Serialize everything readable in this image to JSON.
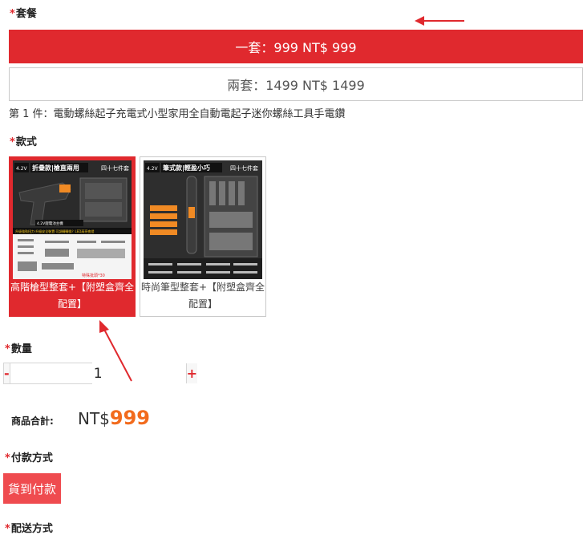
{
  "required_mark": "*",
  "package": {
    "label": "套餐",
    "options": [
      {
        "text": "一套：999 NT$ 999",
        "selected": true
      },
      {
        "text": "兩套：1499 NT$ 1499",
        "selected": false
      }
    ]
  },
  "item_description": "第 1 件：電動螺絲起子充電式小型家用全自動電起子迷你螺絲工具手電鑽",
  "style": {
    "label": "款式",
    "options": [
      {
        "caption": "高階槍型整套+【附塑盒齊全配置】",
        "selected": true,
        "image_texts": {
          "voltage": "4.2V",
          "title": "折疊款|槍直兩用",
          "badge": "四十七件套",
          "label1": "4.2V鋰電池主機",
          "label2": "升級強勁扭力·升級安全裝置·可調轉轉換？LED高亮夜燈",
          "bottom": "特殊批頭*30"
        }
      },
      {
        "caption": "時尚筆型整套+【附塑盒齊全配置】",
        "selected": false,
        "image_texts": {
          "voltage": "4.2V",
          "title": "筆式款|輕盈小巧",
          "badge": "四十七件套"
        }
      }
    ]
  },
  "quantity": {
    "label": "數量",
    "minus": "-",
    "plus": "+",
    "value": "1"
  },
  "total": {
    "label": "商品合計:",
    "currency": "NT$",
    "amount": "999"
  },
  "payment": {
    "label": "付款方式",
    "option": "貨到付款"
  },
  "delivery": {
    "label": "配送方式"
  },
  "colors": {
    "accent": "#e0292e",
    "price": "#f26b1d"
  }
}
